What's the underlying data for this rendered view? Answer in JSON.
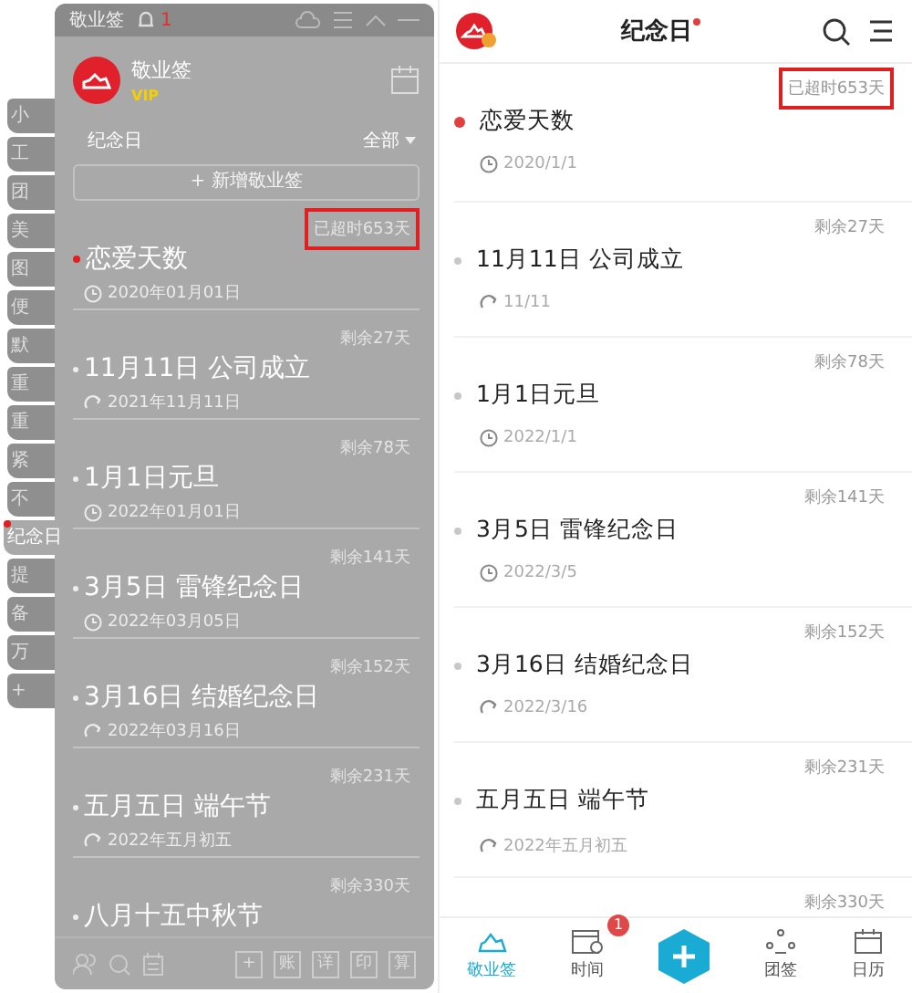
{
  "side_tabs": [
    {
      "label": "小",
      "selected": false
    },
    {
      "label": "工",
      "selected": false
    },
    {
      "label": "团",
      "selected": false
    },
    {
      "label": "美",
      "selected": false
    },
    {
      "label": "图",
      "selected": false
    },
    {
      "label": "便",
      "selected": false
    },
    {
      "label": "默",
      "selected": false
    },
    {
      "label": "重",
      "selected": false
    },
    {
      "label": "重",
      "selected": false
    },
    {
      "label": "紧",
      "selected": false
    },
    {
      "label": "不",
      "selected": false
    },
    {
      "label": "纪念日",
      "selected": true
    },
    {
      "label": "提",
      "selected": false
    },
    {
      "label": "备",
      "selected": false
    },
    {
      "label": "万",
      "selected": false
    },
    {
      "label": "+",
      "selected": false
    }
  ],
  "desktop": {
    "window_title": "敬业签",
    "notification_count": "1",
    "user_name": "敬业签",
    "badge": "VIP",
    "section": "纪念日",
    "filter": "全部",
    "new_button": "+ 新增敬业签",
    "items": [
      {
        "status": "已超时653天",
        "title": "恋爱天数",
        "date": "2020年01月01日",
        "repeat": false,
        "overdue": true,
        "highlighted": true
      },
      {
        "status": "剩余27天",
        "title": "11月11日 公司成立",
        "date": "2021年11月11日",
        "repeat": true,
        "overdue": false,
        "highlighted": false
      },
      {
        "status": "剩余78天",
        "title": "1月1日元旦",
        "date": "2022年01月01日",
        "repeat": false,
        "overdue": false,
        "highlighted": false
      },
      {
        "status": "剩余141天",
        "title": "3月5日 雷锋纪念日",
        "date": "2022年03月05日",
        "repeat": false,
        "overdue": false,
        "highlighted": false
      },
      {
        "status": "剩余152天",
        "title": "3月16日 结婚纪念日",
        "date": "2022年03月16日",
        "repeat": true,
        "overdue": false,
        "highlighted": false
      },
      {
        "status": "剩余231天",
        "title": "五月五日 端午节",
        "date": "2022年五月初五",
        "repeat": true,
        "overdue": false,
        "highlighted": false
      },
      {
        "status": "剩余330天",
        "title": "八月十五中秋节",
        "overdue": false,
        "highlighted": false
      }
    ],
    "toolbar_buttons": [
      "+",
      "账",
      "详",
      "印",
      "算"
    ]
  },
  "mobile": {
    "title": "纪念日",
    "items": [
      {
        "status": "已超时653天",
        "title": "恋爱天数",
        "date": "2020/1/1",
        "repeat": false,
        "overdue": true,
        "highlighted": true
      },
      {
        "status": "剩余27天",
        "title": "11月11日 公司成立",
        "date": "11/11",
        "repeat": true,
        "overdue": false,
        "highlighted": false
      },
      {
        "status": "剩余78天",
        "title": "1月1日元旦",
        "date": "2022/1/1",
        "repeat": false,
        "overdue": false,
        "highlighted": false
      },
      {
        "status": "剩余141天",
        "title": "3月5日 雷锋纪念日",
        "date": "2022/3/5",
        "repeat": false,
        "overdue": false,
        "highlighted": false
      },
      {
        "status": "剩余152天",
        "title": "3月16日 结婚纪念日",
        "date": "2022/3/16",
        "repeat": true,
        "overdue": false,
        "highlighted": false
      },
      {
        "status": "剩余231天",
        "title": "五月五日 端午节",
        "date": "2022年五月初五",
        "repeat": true,
        "overdue": false,
        "highlighted": false
      },
      {
        "status": "剩余330天",
        "highlighted": false
      }
    ],
    "nav": [
      {
        "kind": "notes",
        "label": "敬业签",
        "selected": true
      },
      {
        "kind": "time",
        "label": "时间",
        "selected": false,
        "badge": "1"
      },
      {
        "kind": "add",
        "selected": false
      },
      {
        "kind": "team",
        "label": "团签",
        "selected": false
      },
      {
        "kind": "calendar",
        "label": "日历",
        "selected": false
      }
    ]
  }
}
